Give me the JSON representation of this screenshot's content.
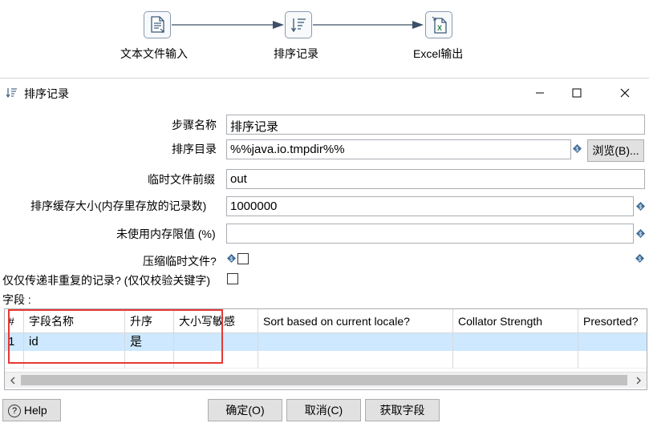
{
  "flow": {
    "steps": [
      {
        "label": "文本文件输入",
        "icon": "text-file-input-icon"
      },
      {
        "label": "排序记录",
        "icon": "sort-rows-icon"
      },
      {
        "label": "Excel输出",
        "icon": "excel-output-icon"
      }
    ]
  },
  "dialog": {
    "title": "排序记录",
    "fields": {
      "step_name_label": "步骤名称",
      "step_name_value": "排序记录",
      "sort_dir_label": "排序目录",
      "sort_dir_value": "%%java.io.tmpdir%%",
      "browse_label": "浏览(B)...",
      "prefix_label": "临时文件前缀",
      "prefix_value": "out",
      "buffer_label": "排序缓存大小(内存里存放的记录数)",
      "buffer_value": "1000000",
      "free_mem_label": "未使用内存限值 (%)",
      "free_mem_value": "",
      "compress_label": "压缩临时文件?",
      "unique_label": "仅仅传递非重复的记录? (仅仅校验关键字)",
      "fields_label": "字段 :"
    },
    "table": {
      "columns": [
        "#",
        "字段名称",
        "升序",
        "大小写敏感",
        "Sort based on current locale?",
        "Collator Strength",
        "Presorted?"
      ],
      "rows": [
        {
          "num": "1",
          "name": "id",
          "asc": "是",
          "case": "",
          "locale": "",
          "collator": "",
          "presorted": ""
        }
      ]
    },
    "buttons": {
      "help": "Help",
      "ok": "确定(O)",
      "cancel": "取消(C)",
      "get_fields": "获取字段"
    },
    "colors": {
      "highlight": "#e53935",
      "selected_row": "#cde8ff"
    }
  }
}
